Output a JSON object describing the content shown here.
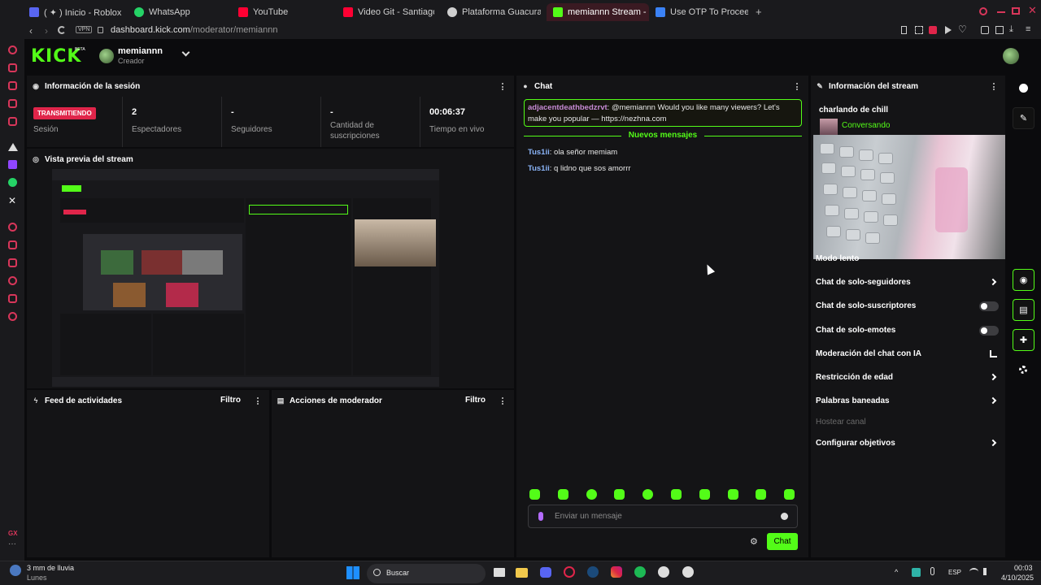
{
  "browser": {
    "tabs": [
      {
        "label": "( ✦ ) Inicio - Roblox",
        "color": "#5865f2"
      },
      {
        "label": "WhatsApp",
        "color": "#25d366"
      },
      {
        "label": "YouTube",
        "color": "#ff0033"
      },
      {
        "label": "Video Git - Santiago Duar",
        "color": "#ff0033"
      },
      {
        "label": "Plataforma Guacurarí",
        "color": "#cfcfcf"
      },
      {
        "label": "memiannn Stream - K",
        "color": "#53fc18"
      },
      {
        "label": "Use OTP To Proceed - de",
        "color": "#3b82f6"
      }
    ],
    "url_host": "dashboard.kick.com",
    "url_path": "/moderator/memiannn",
    "vpn_label": "VPN"
  },
  "header": {
    "logo": "KICK",
    "beta": "BETA",
    "username": "memiannn",
    "role": "Creador"
  },
  "session_panel": {
    "title": "Información de la sesión",
    "live_badge": "TRANSMITIENDO",
    "session_label": "Sesión",
    "stats": [
      {
        "value": "2",
        "label": "Espectadores"
      },
      {
        "value": "-",
        "label": "Seguidores"
      },
      {
        "value": "-",
        "label": "Cantidad de suscripciones"
      },
      {
        "value": "00:06:37",
        "label": "Tiempo en vivo"
      }
    ]
  },
  "preview_panel": {
    "title": "Vista previa del stream"
  },
  "feed_panel": {
    "title": "Feed de actividades",
    "filter": "Filtro"
  },
  "mod_panel": {
    "title": "Acciones de moderador",
    "filter": "Filtro"
  },
  "chat": {
    "title": "Chat",
    "highlight_user": "adjacentdeathbedzrvt",
    "highlight_text": "@memiannn Would you like many viewers? Let's make you popular — https://nezhna.com",
    "new_messages": "Nuevos mensajes",
    "messages": [
      {
        "user": "Tus1ii",
        "text": "ola señor memiam"
      },
      {
        "user": "Tus1ii",
        "text": "q lidno que sos amorrr"
      }
    ],
    "input_placeholder": "Enviar un mensaje",
    "send_label": "Chat"
  },
  "stream_info": {
    "title": "Información del stream",
    "stream_title": "charlando de chill",
    "category": "Conversando",
    "settings": [
      {
        "label": "Modo lento",
        "control": "chevron"
      },
      {
        "label": "Chat de solo-seguidores",
        "control": "chevron"
      },
      {
        "label": "Chat de solo-suscriptores",
        "control": "toggle"
      },
      {
        "label": "Chat de solo-emotes",
        "control": "toggle"
      },
      {
        "label": "Moderación del chat con IA",
        "control": "chart"
      },
      {
        "label": "Restricción de edad",
        "control": "chevron"
      },
      {
        "label": "Palabras baneadas",
        "control": "chevron"
      },
      {
        "label": "Hostear canal",
        "control": "none"
      },
      {
        "label": "Configurar objetivos",
        "control": "chevron"
      }
    ]
  },
  "taskbar": {
    "weather_main": "3 mm de lluvia",
    "weather_sub": "Lunes",
    "search": "Buscar",
    "lang": "ESP",
    "time": "00:03",
    "date": "4/10/2025"
  },
  "colors": {
    "accent": "#53fc18",
    "live": "#e0254a",
    "panel": "#141416"
  }
}
